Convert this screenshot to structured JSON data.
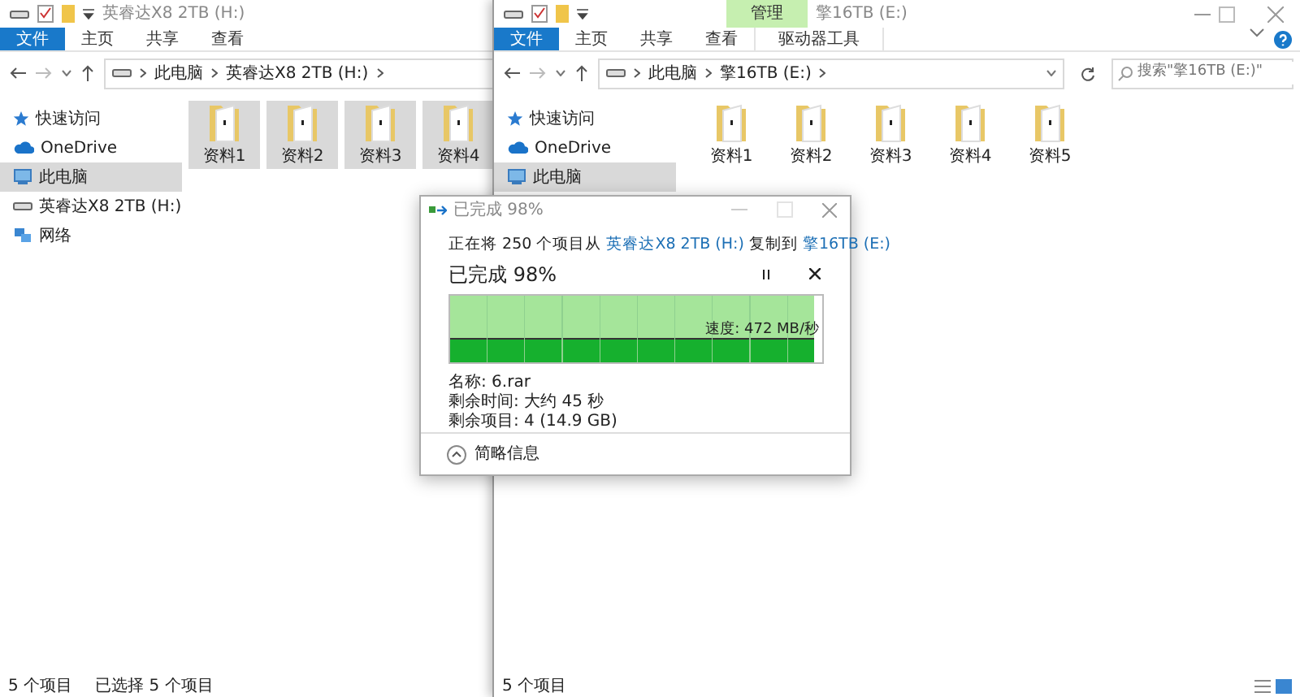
{
  "left_window": {
    "title": "英睿达X8 2TB (H:)",
    "ribbon_tabs": [
      {
        "label": "文件",
        "selected": true
      },
      {
        "label": "主页",
        "selected": false
      },
      {
        "label": "共享",
        "selected": false
      },
      {
        "label": "查看",
        "selected": false
      }
    ],
    "breadcrumb": [
      "此电脑",
      "英睿达X8 2TB (H:)"
    ],
    "sidebar": [
      {
        "kind": "star",
        "label": "快速访问",
        "selected": false
      },
      {
        "kind": "cloud",
        "label": "OneDrive",
        "selected": false
      },
      {
        "kind": "pc",
        "label": "此电脑",
        "selected": true
      },
      {
        "kind": "drive",
        "label": "英睿达X8 2TB (H:)",
        "selected": false
      },
      {
        "kind": "network",
        "label": "网络",
        "selected": false
      }
    ],
    "folders": [
      {
        "label": "资料1",
        "selected": true
      },
      {
        "label": "资料2",
        "selected": true
      },
      {
        "label": "资料3",
        "selected": true
      },
      {
        "label": "资料4",
        "selected": true
      }
    ],
    "status_bar": [
      "5 个项目",
      "已选择 5 个项目"
    ]
  },
  "right_window": {
    "title": "擎16TB (E:)",
    "context_group": "管理",
    "context_tab": "驱动器工具",
    "ribbon_tabs": [
      {
        "label": "文件",
        "selected": true
      },
      {
        "label": "主页",
        "selected": false
      },
      {
        "label": "共享",
        "selected": false
      },
      {
        "label": "查看",
        "selected": false
      }
    ],
    "breadcrumb": [
      "此电脑",
      "擎16TB (E:)"
    ],
    "search": {
      "placeholder": "搜索\"擎16TB (E:)\""
    },
    "sidebar": [
      {
        "kind": "star",
        "label": "快速访问",
        "selected": false
      },
      {
        "kind": "cloud",
        "label": "OneDrive",
        "selected": false
      },
      {
        "kind": "pc",
        "label": "此电脑",
        "selected": true
      }
    ],
    "folders": [
      {
        "label": "资料1",
        "selected": false
      },
      {
        "label": "资料2",
        "selected": false
      },
      {
        "label": "资料3",
        "selected": false
      },
      {
        "label": "资料4",
        "selected": false
      },
      {
        "label": "资料5",
        "selected": false
      }
    ],
    "status_bar": [
      "5 个项目"
    ]
  },
  "copy_dialog": {
    "title": "已完成 98%",
    "description": [
      "正在将 250 个项目从 ",
      {
        "link": "英睿达X8 2TB (H:)"
      },
      " 复制到 ",
      {
        "link": "擎16TB (E:)"
      }
    ],
    "heading": "已完成 98%",
    "level": 0.98,
    "speed": "速度: 472 MB/秒",
    "details": [
      "名称: 6.rar",
      "剩余时间: 大约 45 秒",
      "剩余项目: 4 (14.9 GB)"
    ],
    "toggle": "简略信息"
  }
}
